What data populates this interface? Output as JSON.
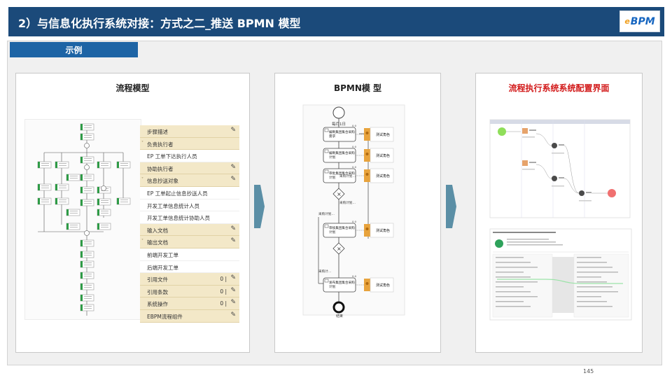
{
  "header": {
    "title": "2）与信息化执行系统对接：方式之二_推送 BPMN 模型"
  },
  "logo": {
    "prefix": "e",
    "text": "BPM"
  },
  "example_tab": {
    "label": "示例"
  },
  "panels": {
    "flow": {
      "title": "流程模型",
      "properties": [
        {
          "type": "section",
          "label": "步骤描述",
          "edit": "✎"
        },
        {
          "type": "section",
          "label": "负责执行者",
          "expand": "˅"
        },
        {
          "type": "item",
          "label": "EP 工单下达执行人员"
        },
        {
          "type": "section",
          "label": "协助执行者",
          "edit": "✎"
        },
        {
          "type": "section",
          "label": "信息抄送对象",
          "expand": "˅",
          "edit": "✎"
        },
        {
          "type": "item",
          "label": "EP 工单起止信息抄送人员"
        },
        {
          "type": "item",
          "label": "开发工单信息统计人员"
        },
        {
          "type": "item",
          "label": "开发工单信息统计协助人员"
        },
        {
          "type": "section",
          "label": "输入文档",
          "edit": "✎"
        },
        {
          "type": "section",
          "label": "输出文档",
          "expand": "˅",
          "edit": "✎"
        },
        {
          "type": "item",
          "label": "前端开发工单"
        },
        {
          "type": "item",
          "label": "后端开发工单"
        },
        {
          "type": "section",
          "label": "引用文件",
          "count": "0 |",
          "edit": "✎"
        },
        {
          "type": "section",
          "label": "引用条款",
          "count": "0 |",
          "edit": "✎"
        },
        {
          "type": "section",
          "label": "系统操作",
          "count": "0 |",
          "edit": "✎"
        },
        {
          "type": "section",
          "label": "EBPM流程组件",
          "edit": "✎"
        }
      ]
    },
    "bpmn": {
      "title": "BPMN模 型",
      "start_label": "每月1日",
      "tasks": [
        {
          "label": "编制集团集合采购\n需求",
          "role": "测试角色",
          "tag": "0.0"
        },
        {
          "label": "编制集团集合采购\n计划",
          "role": "测试角色",
          "tag": "0.0"
        },
        {
          "label": "审批集团集合采购\n计划",
          "role": "测试角色",
          "tag": "0.0"
        },
        {
          "label": "审核集团集合采购\n计划",
          "role": "测试角色",
          "tag": "0.0"
        },
        {
          "label": "发布集团集合采购\n计划",
          "role": "测试角色",
          "tag": "0.0"
        }
      ],
      "flow_labels": [
        "采购计划…",
        "采购计划…",
        "采购计划…",
        "采购计…"
      ],
      "end_label": "结束"
    },
    "config": {
      "title": "流程执行系统系统配置界面"
    }
  },
  "page_number": "145",
  "colors": {
    "header": "#1b4a7a",
    "tab": "#1d64a5",
    "arrow": "#5b8fa6",
    "accent_red": "#d21a1a",
    "task_orange": "#e8a33c",
    "section": "#f3e8c8"
  }
}
